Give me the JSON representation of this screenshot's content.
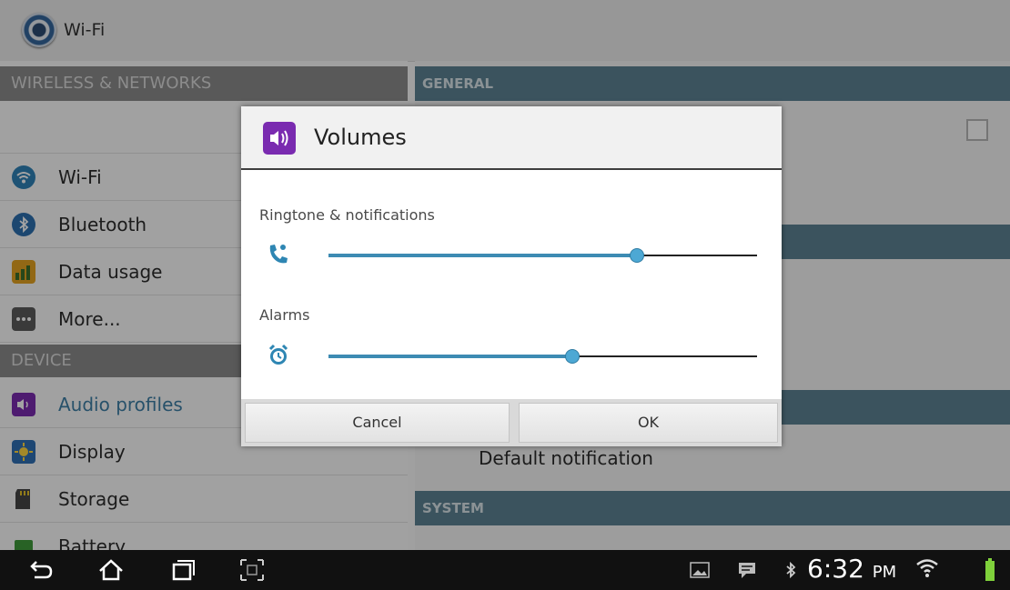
{
  "action_bar": {
    "title": "Wi-Fi"
  },
  "left_pane": {
    "section_wireless": "WIRELESS & NETWORKS",
    "section_device": "DEVICE",
    "items": [
      {
        "label": "Wi-Fi",
        "icon": "wifi-icon"
      },
      {
        "label": "Bluetooth",
        "icon": "bluetooth-icon"
      },
      {
        "label": "Data usage",
        "icon": "data-usage-icon"
      },
      {
        "label": "More...",
        "icon": "more-icon"
      },
      {
        "label": "Audio profiles",
        "icon": "audio-profiles-icon"
      },
      {
        "label": "Display",
        "icon": "display-icon"
      },
      {
        "label": "Storage",
        "icon": "storage-icon"
      },
      {
        "label": "Battery",
        "icon": "battery-icon"
      }
    ]
  },
  "right_pane": {
    "general_header": "GENERAL",
    "system_header": "SYSTEM",
    "default_notification": "Default notification"
  },
  "dialog": {
    "title": "Volumes",
    "ringtone_label": "Ringtone & notifications",
    "ringtone_level": 0.72,
    "alarms_label": "Alarms",
    "alarms_level": 0.57,
    "cancel_label": "Cancel",
    "ok_label": "OK"
  },
  "status_bar": {
    "time": "6:32",
    "ampm": "PM"
  },
  "colors": {
    "accent": "#3d8bb3",
    "thumb": "#4da8d4",
    "dialog_icon": "#7a2bb0"
  }
}
